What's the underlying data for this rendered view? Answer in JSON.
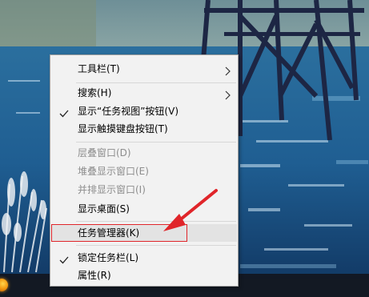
{
  "menu": {
    "items": [
      {
        "label": "工具栏(T)",
        "submenu": true
      },
      {
        "label": "搜索(H)",
        "submenu": true
      },
      {
        "label": "显示“任务视图”按钮(V)",
        "checked": true
      },
      {
        "label": "显示触摸键盘按钮(T)"
      },
      {
        "label": "层叠窗口(D)",
        "disabled": true
      },
      {
        "label": "堆叠显示窗口(E)",
        "disabled": true
      },
      {
        "label": "并排显示窗口(I)",
        "disabled": true
      },
      {
        "label": "显示桌面(S)"
      },
      {
        "label": "任务管理器(K)",
        "highlighted": true
      },
      {
        "label": "锁定任务栏(L)",
        "checked": true
      },
      {
        "label": "属性(R)"
      }
    ]
  },
  "colors": {
    "annotation": "#e0252a",
    "menu_bg": "#f2f2f2",
    "disabled_text": "#8d8d8d"
  },
  "icons": {
    "submenu": "chevron-right-icon",
    "check": "checkmark-icon",
    "start": "start-orb-icon"
  }
}
